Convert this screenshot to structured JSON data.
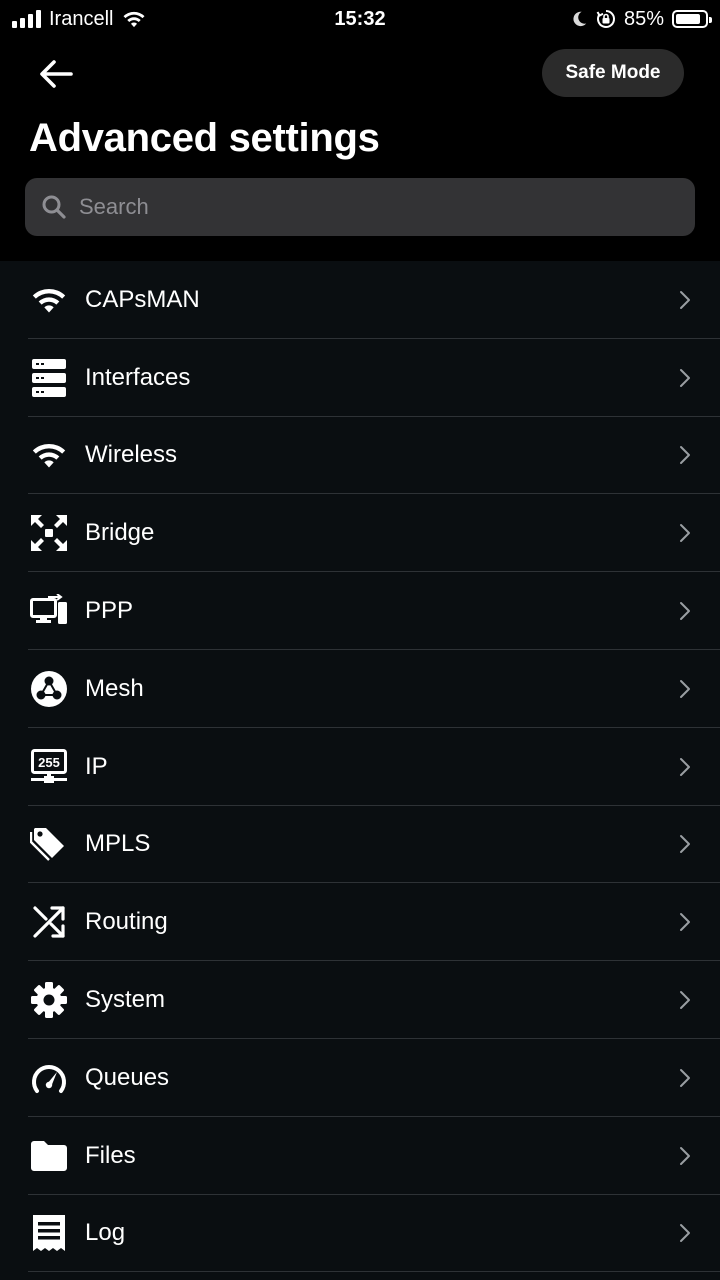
{
  "status_bar": {
    "carrier": "Irancell",
    "time": "15:32",
    "battery_percent": "85%",
    "battery_level": 0.85
  },
  "header": {
    "back_icon": "arrow-left-icon",
    "safe_mode_label": "Safe Mode",
    "title": "Advanced settings"
  },
  "search": {
    "placeholder": "Search",
    "value": ""
  },
  "menu": {
    "items": [
      {
        "label": "CAPsMAN",
        "icon": "wifi-icon"
      },
      {
        "label": "Interfaces",
        "icon": "server-icon"
      },
      {
        "label": "Wireless",
        "icon": "wifi-icon"
      },
      {
        "label": "Bridge",
        "icon": "expand-arrows-icon"
      },
      {
        "label": "PPP",
        "icon": "desktop-transfer-icon"
      },
      {
        "label": "Mesh",
        "icon": "mesh-icon"
      },
      {
        "label": "IP",
        "icon": "ip-255-icon"
      },
      {
        "label": "MPLS",
        "icon": "tags-icon"
      },
      {
        "label": "Routing",
        "icon": "shuffle-icon"
      },
      {
        "label": "System",
        "icon": "gear-icon"
      },
      {
        "label": "Queues",
        "icon": "speedometer-icon"
      },
      {
        "label": "Files",
        "icon": "folder-icon"
      },
      {
        "label": "Log",
        "icon": "log-list-icon"
      }
    ]
  },
  "colors": {
    "background": "#000000",
    "list_background": "#0a0e11",
    "divider": "#2e3236",
    "search_background": "#333335",
    "button_background": "#2b2b2b"
  }
}
